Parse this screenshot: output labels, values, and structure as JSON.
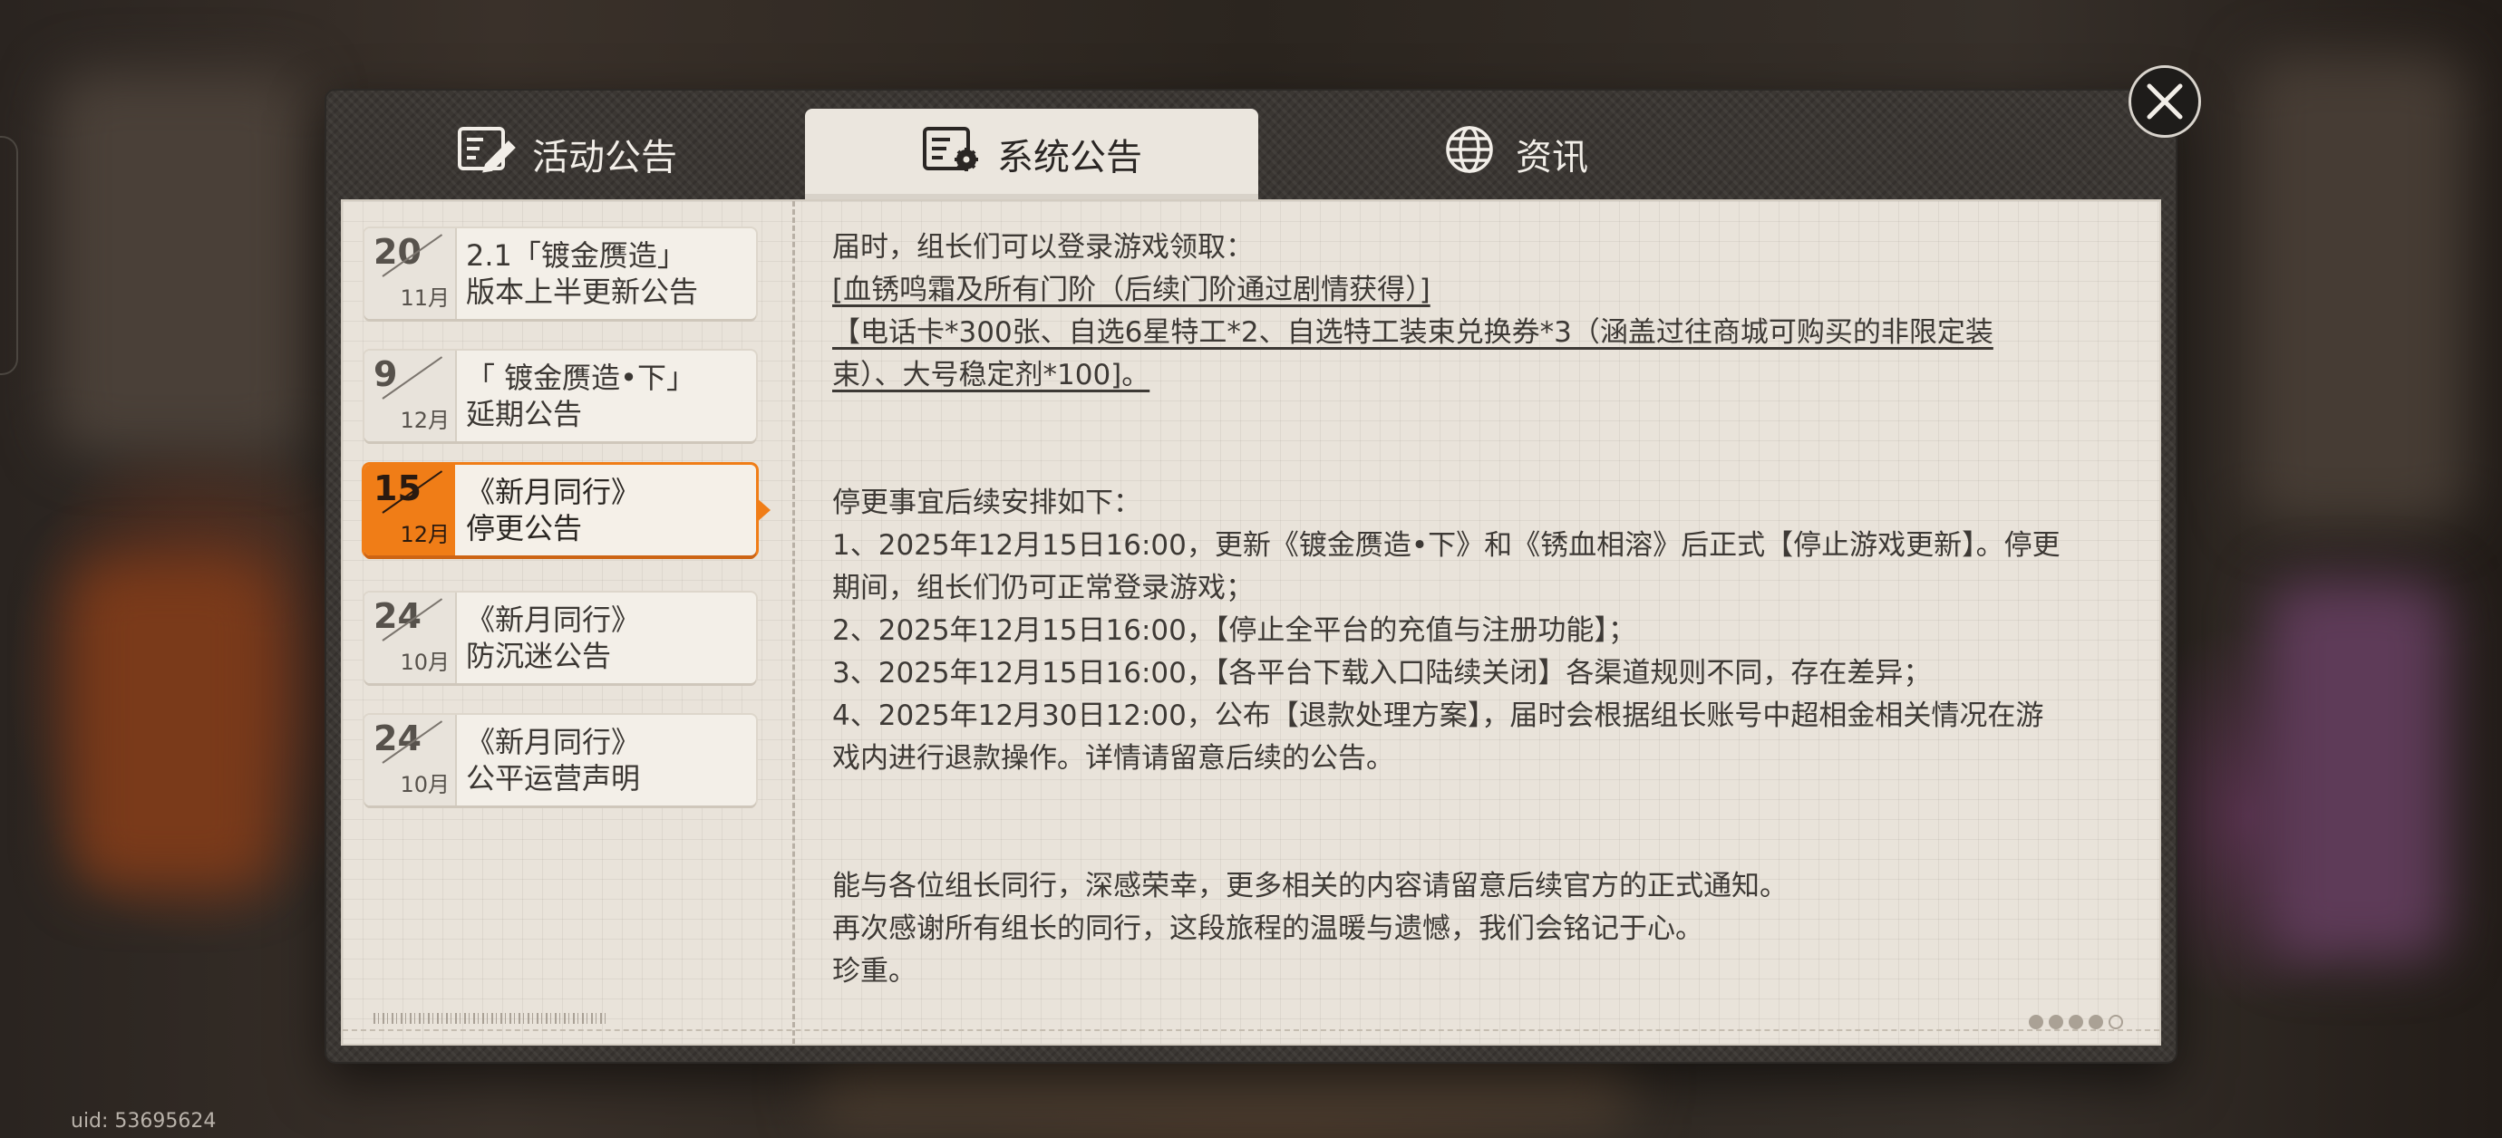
{
  "uid": "uid: 53695624",
  "tabs": [
    {
      "label": "活动公告",
      "icon": "notice-edit-icon"
    },
    {
      "label": "系统公告",
      "icon": "notice-gear-icon"
    },
    {
      "label": "资讯",
      "icon": "globe-icon"
    }
  ],
  "active_tab": 1,
  "announcements": [
    {
      "day": "20",
      "month": "11月",
      "title": "2.1「镀金赝造」\n版本上半更新公告"
    },
    {
      "day": "9",
      "month": "12月",
      "title": "「 镀金赝造•下」\n延期公告"
    },
    {
      "day": "15",
      "month": "12月",
      "title": "《新月同行》\n停更公告"
    },
    {
      "day": "24",
      "month": "10月",
      "title": "《新月同行》\n防沉迷公告"
    },
    {
      "day": "24",
      "month": "10月",
      "title": "《新月同行》\n公平运营声明"
    }
  ],
  "active_announcement": 2,
  "content": {
    "p1": "届时，组长们可以登录游戏领取：",
    "p2": "[血锈鸣霜及所有门阶（后续门阶通过剧情获得）]",
    "p3a": "【电话卡*300张、自选6星特工*2、自选特工装束兑换券*3（涵盖过往商城可购买的非限定装",
    "p3b": "束）、大号稳定剂*100]。",
    "p4": "停更事宜后续安排如下：",
    "p5a": "1、2025年12月15日16:00，更新《镀金赝造•下》和《锈血相溶》后正式【停止游戏更新】。停更",
    "p5b": "期间，组长们仍可正常登录游戏；",
    "p6": "2、2025年12月15日16:00，【停止全平台的充值与注册功能】；",
    "p7": "3、2025年12月15日16:00，【各平台下载入口陆续关闭】各渠道规则不同，存在差异；",
    "p8a": "4、2025年12月30日12:00，公布【退款处理方案】，届时会根据组长账号中超相金相关情况在游",
    "p8b": "戏内进行退款操作。详情请留意后续的公告。",
    "p9": "能与各位组长同行，深感荣幸，更多相关的内容请留意后续官方的正式通知。",
    "p10": "再次感谢所有组长的同行，这段旅程的温暖与遗憾，我们会铭记于心。",
    "p11": "珍重。"
  },
  "colors": {
    "accent": "#f07d17",
    "paper": "#e9e3da",
    "frame": "#3b3733"
  }
}
